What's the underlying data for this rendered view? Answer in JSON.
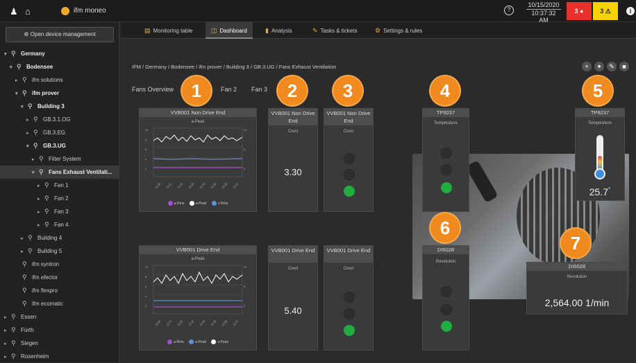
{
  "header": {
    "app_name": "ifm moneo",
    "date": "10/15/2020",
    "time": "10:37:32 AM",
    "alarm_red_label": "3",
    "alarm_yellow_label": "3",
    "colors": {
      "accent": "#f2a92c",
      "alarm_red": "#e8302a",
      "alarm_yellow": "#f6d200"
    }
  },
  "sidebar": {
    "open_device_management": "Open device management",
    "tree": [
      {
        "label": "Germany",
        "bold": true,
        "arrow": "▾"
      },
      {
        "label": "Bodensee",
        "bold": true,
        "arrow": "▾"
      },
      {
        "label": "ifm solutions",
        "bold": false,
        "arrow": "▸"
      },
      {
        "label": "ifm prover",
        "bold": true,
        "arrow": "▾"
      },
      {
        "label": "Building 3",
        "bold": true,
        "arrow": "▾"
      },
      {
        "label": "GB.3.1.OG",
        "bold": false,
        "arrow": "▸"
      },
      {
        "label": "GB.3.EG",
        "bold": false,
        "arrow": "▸"
      },
      {
        "label": "GB.3.UG",
        "bold": true,
        "arrow": "▾"
      },
      {
        "label": "Filter System",
        "bold": false,
        "arrow": "▸"
      },
      {
        "label": "Fans Exhaust Ventilati...",
        "bold": true,
        "arrow": "▾"
      },
      {
        "label": "Fan 1",
        "bold": false,
        "arrow": "▸"
      },
      {
        "label": "Fan 2",
        "bold": false,
        "arrow": "▸"
      },
      {
        "label": "Fan 3",
        "bold": false,
        "arrow": "▸"
      },
      {
        "label": "Fan 4",
        "bold": false,
        "arrow": "▸"
      },
      {
        "label": "Building 4",
        "bold": false,
        "arrow": "▸"
      },
      {
        "label": "Building 5",
        "bold": false,
        "arrow": "▸"
      },
      {
        "label": "ifm syntron",
        "bold": false,
        "arrow": ""
      },
      {
        "label": "ifm efector",
        "bold": false,
        "arrow": ""
      },
      {
        "label": "ifm flexpro",
        "bold": false,
        "arrow": ""
      },
      {
        "label": "ifm ecomatic",
        "bold": false,
        "arrow": ""
      },
      {
        "label": "Essen",
        "bold": false,
        "arrow": "▸"
      },
      {
        "label": "Fürth",
        "bold": false,
        "arrow": "▸"
      },
      {
        "label": "Siegen",
        "bold": false,
        "arrow": "▸"
      },
      {
        "label": "Rosenheim",
        "bold": false,
        "arrow": "▸"
      }
    ]
  },
  "tabs": [
    {
      "label": "Monitoring table",
      "icon": "▤"
    },
    {
      "label": "Dashboard",
      "icon": "◫"
    },
    {
      "label": "Analysis",
      "icon": "▮"
    },
    {
      "label": "Tasks & tickets",
      "icon": "✎"
    },
    {
      "label": "Settings & rules",
      "icon": "⚙"
    }
  ],
  "breadcrumb": "IFM / Germany / Bodensee / ifm prover / Building 3 / GB.3.UG / Fans Exhaust Ventilation",
  "subtabs": [
    "Fans Overview",
    "Fan 2",
    "Fan 3"
  ],
  "markers": [
    "1",
    "2",
    "3",
    "4",
    "5",
    "6",
    "7"
  ],
  "widgets": {
    "chart1": {
      "title": "VVB001 Non Drive End",
      "subtitle": "a-Peak",
      "legend": [
        "a-Rms",
        "a-Peak",
        "v-Rms"
      ]
    },
    "value1": {
      "title": "VVB001 Non Drive End",
      "subtitle": "Crest",
      "value": "3.30"
    },
    "lamp1": {
      "title": "VVB001 Non Drive End",
      "subtitle": "Crest"
    },
    "lamp2": {
      "title": "TP9237",
      "subtitle": "Temperature"
    },
    "temp": {
      "title": "TP9237",
      "subtitle": "Temperature",
      "value": "25.7",
      "unit": "°"
    },
    "chart2": {
      "title": "VVB001 Drive End",
      "subtitle": "a-Peak",
      "legend": [
        "a-Rms",
        "a-Peak",
        "v-Peak"
      ]
    },
    "value2": {
      "title": "VVB001 Drive End",
      "subtitle": "Crest",
      "value": "5.40"
    },
    "lamp3": {
      "title": "VVB001 Drive End",
      "subtitle": "Crest"
    },
    "lamp4": {
      "title": "DI5028",
      "subtitle": "Revolution"
    },
    "rev": {
      "title": "DI5028",
      "subtitle": "Revolution",
      "value": "2,564.00 1/min"
    }
  }
}
